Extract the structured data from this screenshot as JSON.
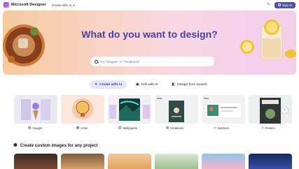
{
  "header": {
    "brand": "Microsoft Designer",
    "create_menu": "Create with AI",
    "signin_label": "Sign in"
  },
  "hero": {
    "title": "What do you want to design?",
    "search_placeholder": "Try \"Images\" or \"Invitations\""
  },
  "tabs": [
    {
      "label": "Create with AI",
      "icon": "sparkle-icon",
      "active": true
    },
    {
      "label": "Edit with AI",
      "icon": "edit-image-icon",
      "active": false
    },
    {
      "label": "Design from scratch",
      "icon": "canvas-icon",
      "active": false
    }
  ],
  "categories": [
    {
      "label": "Images",
      "icon": "image-icon"
    },
    {
      "label": "Icons",
      "icon": "icon-set-icon"
    },
    {
      "label": "Wallpapers",
      "icon": "wallpaper-icon"
    },
    {
      "label": "Invitations",
      "icon": "invitation-icon"
    },
    {
      "label": "Banners",
      "icon": "banner-icon"
    },
    {
      "label": "Posters",
      "icon": "poster-icon"
    }
  ],
  "card_tags": [
    "New",
    "New"
  ],
  "section": {
    "title": "Create custom images for any project"
  },
  "colors": {
    "accent": "#4f52b2",
    "hero_title": "#4a3fa8",
    "active_tab_bg": "#e6e4f8"
  }
}
